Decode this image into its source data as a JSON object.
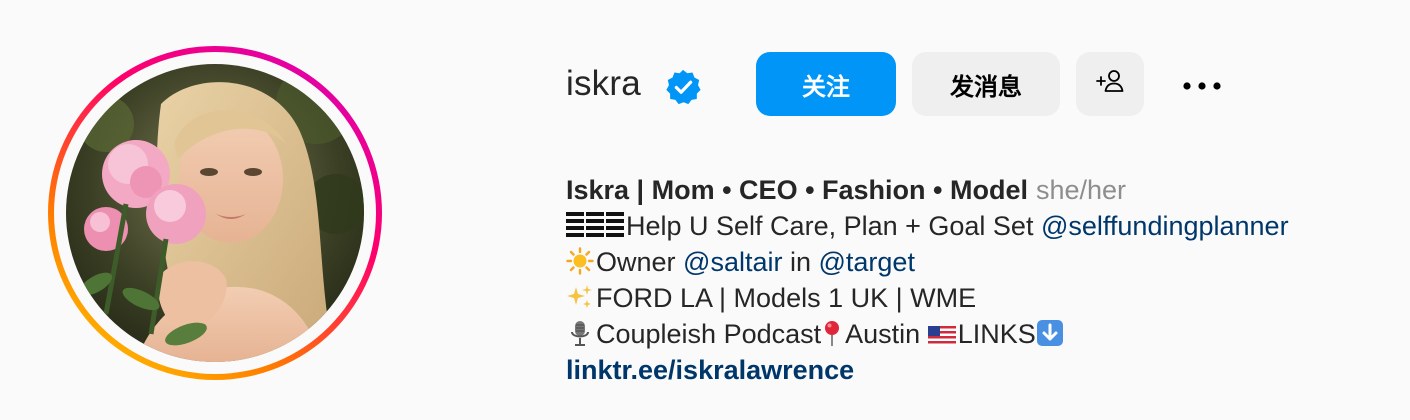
{
  "profile": {
    "username": "iskra",
    "verified": true,
    "buttons": {
      "follow": "关注",
      "message": "发消息",
      "add_user_icon": "add-user-icon",
      "more_icon": "more-horizontal-icon"
    },
    "bio": {
      "name": "Iskra | Mom • CEO • Fashion • Model",
      "pronouns": "she/her",
      "line1_text": "Help U Self Care, Plan + Goal Set ",
      "line1_mention": "@selffundingplanner",
      "line2_prefix": "Owner ",
      "line2_mention1": "@saltair",
      "line2_middle": " in ",
      "line2_mention2": "@target",
      "line3_text": "FORD LA | Models 1 UK | WME",
      "line4_text1": "Coupleish Podcast",
      "line4_text2": "Austin ",
      "line4_text3": "LINKS",
      "link": "linktr.ee/iskralawrence"
    },
    "colors": {
      "follow_blue": "#0095f6",
      "mention_blue": "#00376b",
      "verified_blue": "#0095f6",
      "button_gray": "#efefef"
    }
  }
}
